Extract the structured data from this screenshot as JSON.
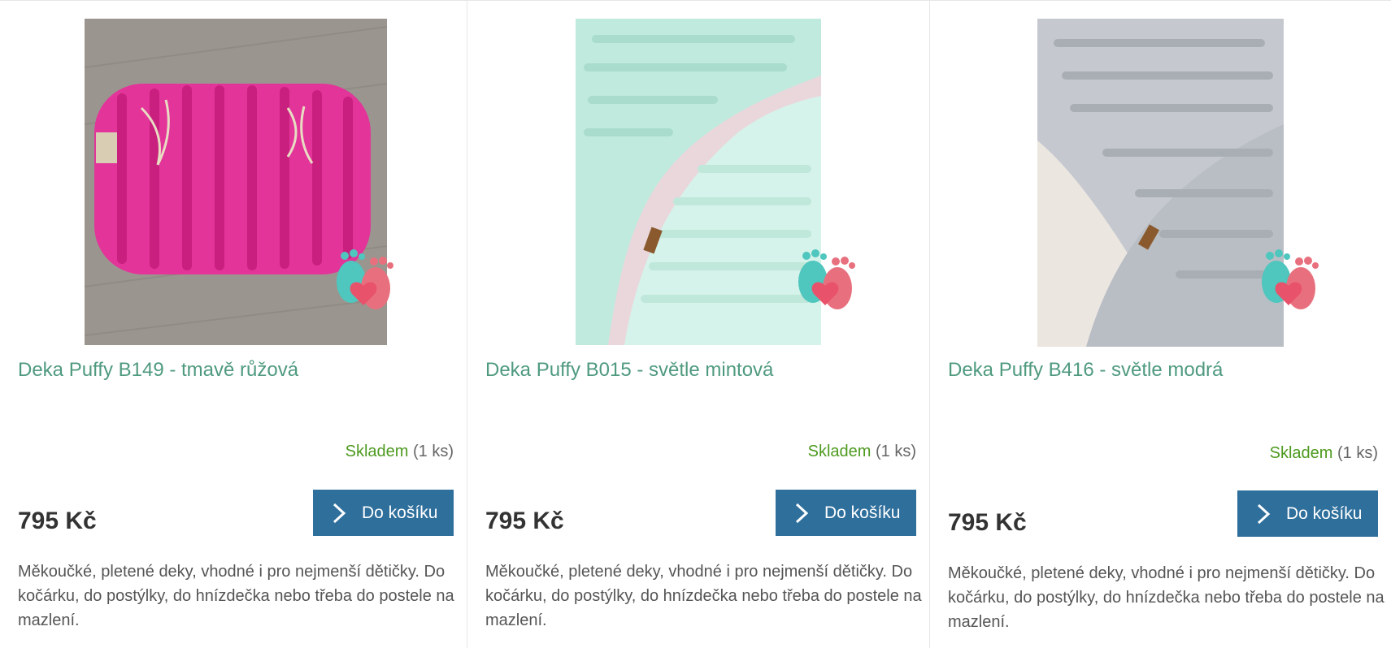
{
  "products": [
    {
      "name": "Deka Puffy B149 - tmavě růžová",
      "availability": "Skladem",
      "quantity": "(1 ks)",
      "price": "795 Kč",
      "cart_label": "Do košíku",
      "description": "Měkoučké, pletené deky, vhodné i pro nejmenší dětičky. Do kočárku, do postýlky, do hnízdečka nebo třeba do postele na mazlení.",
      "image_color": "#e8379a"
    },
    {
      "name": "Deka Puffy B015 - světle mintová",
      "availability": "Skladem",
      "quantity": "(1 ks)",
      "price": "795 Kč",
      "cart_label": "Do košíku",
      "description": "Měkoučké, pletené deky, vhodné i pro nejmenší dětičky. Do kočárku, do postýlky, do hnízdečka nebo třeba do postele na mazlení.",
      "image_color": "#c9efe4"
    },
    {
      "name": "Deka Puffy B416 - světle modrá",
      "availability": "Skladem",
      "quantity": "(1 ks)",
      "price": "795 Kč",
      "cart_label": "Do košíku",
      "description": "Měkoučké, pletené deky, vhodné i pro nejmenší dětičky. Do kočárku, do postýlky, do hnízdečka nebo třeba do postele na mazlení.",
      "image_color": "#c8ccd2"
    }
  ],
  "colors": {
    "name": "#4f9a7e",
    "in_stock": "#4d9a1f",
    "button": "#2f6f9c",
    "price": "#333333",
    "badge_teal": "#4fc6be",
    "badge_pink": "#e8707e"
  },
  "icons": {
    "cart_button": "chevron-right-icon",
    "watermark": "baby-feet-heart-logo"
  }
}
